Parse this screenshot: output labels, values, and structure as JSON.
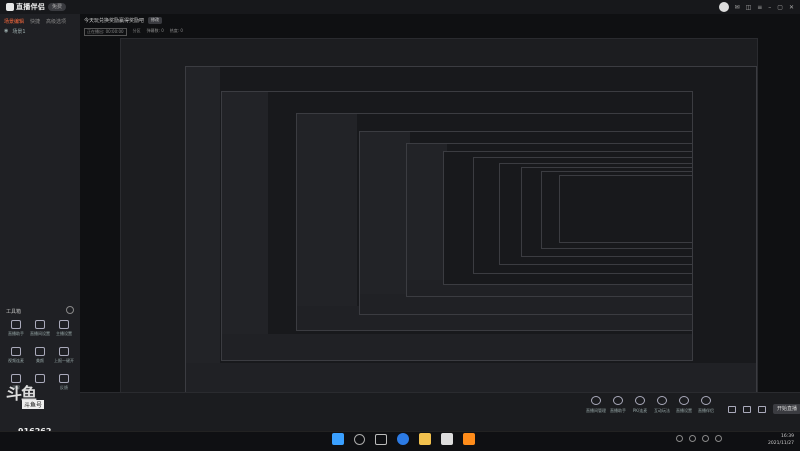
{
  "app": {
    "title": "直播伴侣",
    "version": "免费"
  },
  "sidebar": {
    "tabs": [
      {
        "label": "场景编辑"
      },
      {
        "label": "快捷"
      },
      {
        "label": "高级选项"
      }
    ],
    "scene": {
      "label": "场景1"
    },
    "tools_title": "工具箱",
    "tools": [
      {
        "label": "直播助手",
        "icon": "live-helper-icon"
      },
      {
        "label": "直播间设置",
        "icon": "room-settings-icon"
      },
      {
        "label": "主播设置",
        "icon": "anchor-settings-icon"
      },
      {
        "label": "视频连麦",
        "icon": "video-link-icon"
      },
      {
        "label": "美颜",
        "icon": "beauty-icon"
      },
      {
        "label": "上报一键开",
        "icon": "report-icon"
      },
      {
        "label": "录屏",
        "icon": "record-icon"
      },
      {
        "label": "",
        "icon": "blank-icon"
      },
      {
        "label": "反馈",
        "icon": "feedback-icon"
      }
    ],
    "brand_big": "斗鱼",
    "brand_small": "斗鱼号",
    "room_id": "916262"
  },
  "main": {
    "room_title": "今天玩兑换奖励赢得奖励吧",
    "room_badge": "修改",
    "meta": [
      "正在播出: 00:00:00",
      "分区",
      "弹幕数: 0",
      "热度: 0"
    ]
  },
  "bottom": {
    "tools": [
      {
        "label": "直播间管理",
        "icon": "room-manage-icon"
      },
      {
        "label": "直播助手",
        "icon": "assistant-icon"
      },
      {
        "label": "PK/连麦",
        "icon": "pk-icon"
      },
      {
        "label": "互动玩法",
        "icon": "interact-icon"
      },
      {
        "label": "直播设置",
        "icon": "settings-icon"
      },
      {
        "label": "直播伴侣",
        "icon": "partner-icon"
      }
    ],
    "live_button": "开始直播"
  },
  "taskbar": {
    "time": "16:39",
    "date": "2021/11/27",
    "apps": [
      "windows-start-icon",
      "search-icon",
      "task-view-icon",
      "browser-icon",
      "explorer-icon",
      "store-icon",
      "app-icon"
    ]
  },
  "colors": {
    "accent": "#ff6b3d",
    "taskbar": "#0f1013"
  }
}
